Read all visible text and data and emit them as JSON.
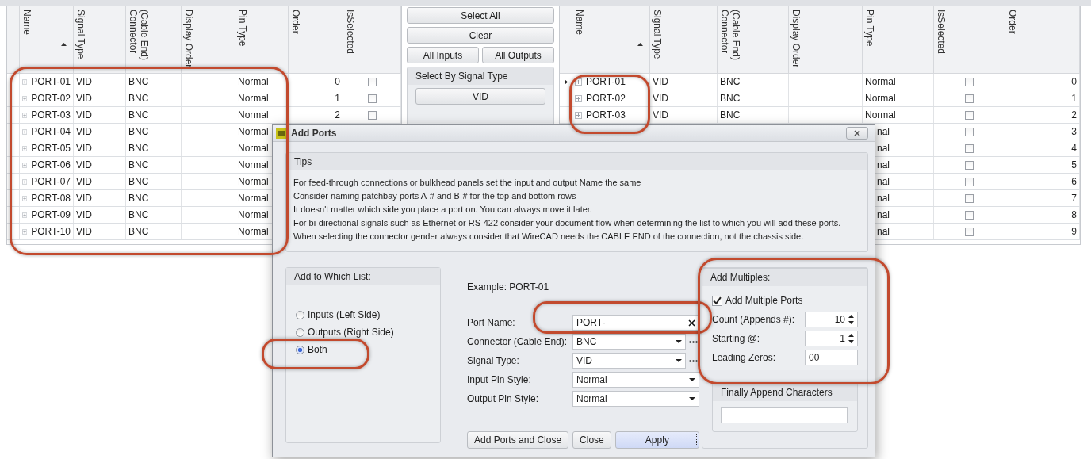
{
  "left_grid": {
    "columns": [
      {
        "label": "Name",
        "sorted": true
      },
      {
        "label": "Signal Type",
        "sorted": false
      },
      {
        "label": "(Cable End) Connector",
        "sorted": false
      },
      {
        "label": "Display Order",
        "sorted": false
      },
      {
        "label": "Pin Type",
        "sorted": false
      },
      {
        "label": "Order",
        "sorted": false
      },
      {
        "label": "IsSelected",
        "sorted": false
      }
    ],
    "rows": [
      {
        "cells": [
          {
            "kind": "name",
            "text": "PORT-01"
          },
          {
            "kind": "text",
            "text": "VID"
          },
          {
            "kind": "text",
            "text": "BNC"
          },
          {
            "kind": "blank"
          },
          {
            "kind": "text",
            "text": "Normal"
          },
          {
            "kind": "number",
            "text": "0"
          },
          {
            "kind": "checkbox",
            "checked": false
          }
        ]
      },
      {
        "cells": [
          {
            "kind": "name",
            "text": "PORT-02"
          },
          {
            "kind": "text",
            "text": "VID"
          },
          {
            "kind": "text",
            "text": "BNC"
          },
          {
            "kind": "blank"
          },
          {
            "kind": "text",
            "text": "Normal"
          },
          {
            "kind": "number",
            "text": "1"
          },
          {
            "kind": "checkbox",
            "checked": false
          }
        ]
      },
      {
        "cells": [
          {
            "kind": "name",
            "text": "PORT-03"
          },
          {
            "kind": "text",
            "text": "VID"
          },
          {
            "kind": "text",
            "text": "BNC"
          },
          {
            "kind": "blank"
          },
          {
            "kind": "text",
            "text": "Normal"
          },
          {
            "kind": "number",
            "text": "2"
          },
          {
            "kind": "checkbox",
            "checked": false
          }
        ]
      },
      {
        "cells": [
          {
            "kind": "name",
            "text": "PORT-04"
          },
          {
            "kind": "text",
            "text": "VID"
          },
          {
            "kind": "text",
            "text": "BNC"
          },
          {
            "kind": "blank"
          },
          {
            "kind": "text",
            "text": "Normal"
          },
          {
            "kind": "blank"
          },
          {
            "kind": "blank"
          }
        ]
      },
      {
        "cells": [
          {
            "kind": "name",
            "text": "PORT-05"
          },
          {
            "kind": "text",
            "text": "VID"
          },
          {
            "kind": "text",
            "text": "BNC"
          },
          {
            "kind": "blank"
          },
          {
            "kind": "text",
            "text": "Normal"
          },
          {
            "kind": "blank"
          },
          {
            "kind": "blank"
          }
        ]
      },
      {
        "cells": [
          {
            "kind": "name",
            "text": "PORT-06"
          },
          {
            "kind": "text",
            "text": "VID"
          },
          {
            "kind": "text",
            "text": "BNC"
          },
          {
            "kind": "blank"
          },
          {
            "kind": "text",
            "text": "Normal"
          },
          {
            "kind": "blank"
          },
          {
            "kind": "blank"
          }
        ]
      },
      {
        "cells": [
          {
            "kind": "name",
            "text": "PORT-07"
          },
          {
            "kind": "text",
            "text": "VID"
          },
          {
            "kind": "text",
            "text": "BNC"
          },
          {
            "kind": "blank"
          },
          {
            "kind": "text",
            "text": "Normal"
          },
          {
            "kind": "blank"
          },
          {
            "kind": "blank"
          }
        ]
      },
      {
        "cells": [
          {
            "kind": "name",
            "text": "PORT-08"
          },
          {
            "kind": "text",
            "text": "VID"
          },
          {
            "kind": "text",
            "text": "BNC"
          },
          {
            "kind": "blank"
          },
          {
            "kind": "text",
            "text": "Normal"
          },
          {
            "kind": "blank"
          },
          {
            "kind": "blank"
          }
        ]
      },
      {
        "cells": [
          {
            "kind": "name",
            "text": "PORT-09"
          },
          {
            "kind": "text",
            "text": "VID"
          },
          {
            "kind": "text",
            "text": "BNC"
          },
          {
            "kind": "blank"
          },
          {
            "kind": "text",
            "text": "Normal"
          },
          {
            "kind": "blank"
          },
          {
            "kind": "blank"
          }
        ]
      },
      {
        "cells": [
          {
            "kind": "name",
            "text": "PORT-10"
          },
          {
            "kind": "text",
            "text": "VID"
          },
          {
            "kind": "text",
            "text": "BNC"
          },
          {
            "kind": "blank"
          },
          {
            "kind": "text",
            "text": "Normal"
          },
          {
            "kind": "blank"
          },
          {
            "kind": "blank"
          }
        ]
      }
    ]
  },
  "selection_panel": {
    "buttons": [
      "Select All",
      "Clear",
      "All Inputs",
      "All Outputs"
    ],
    "signal_group": {
      "title": "Select By Signal Type",
      "buttons": [
        "VID"
      ]
    }
  },
  "right_grid": {
    "columns": [
      {
        "label": "Name",
        "sorted": true
      },
      {
        "label": "Signal Type",
        "sorted": false
      },
      {
        "label": "(Cable End) Connector",
        "sorted": false
      },
      {
        "label": "Display Order",
        "sorted": false
      },
      {
        "label": "Pin Type",
        "sorted": false
      },
      {
        "label": "IsSelected",
        "sorted": false
      },
      {
        "label": "Order",
        "sorted": false
      }
    ],
    "rows": [
      {
        "current": true,
        "cells": [
          {
            "kind": "name",
            "text": "PORT-01"
          },
          {
            "kind": "text",
            "text": "VID"
          },
          {
            "kind": "text",
            "text": "BNC"
          },
          {
            "kind": "blank"
          },
          {
            "kind": "text",
            "text": "Normal"
          },
          {
            "kind": "checkbox",
            "checked": false
          },
          {
            "kind": "number",
            "text": "0"
          }
        ]
      },
      {
        "current": false,
        "cells": [
          {
            "kind": "name",
            "text": "PORT-02"
          },
          {
            "kind": "text",
            "text": "VID"
          },
          {
            "kind": "text",
            "text": "BNC"
          },
          {
            "kind": "blank"
          },
          {
            "kind": "text",
            "text": "Normal"
          },
          {
            "kind": "checkbox",
            "checked": false
          },
          {
            "kind": "number",
            "text": "1"
          }
        ]
      },
      {
        "current": false,
        "cells": [
          {
            "kind": "name",
            "text": "PORT-03"
          },
          {
            "kind": "text",
            "text": "VID"
          },
          {
            "kind": "text",
            "text": "BNC"
          },
          {
            "kind": "blank"
          },
          {
            "kind": "text",
            "text": "Normal"
          },
          {
            "kind": "checkbox",
            "checked": false
          },
          {
            "kind": "number",
            "text": "2"
          }
        ]
      },
      {
        "cells": [
          {
            "kind": "blank"
          },
          {
            "kind": "blank"
          },
          {
            "kind": "blank"
          },
          {
            "kind": "blank"
          },
          {
            "kind": "cut",
            "text": "nal"
          },
          {
            "kind": "checkbox",
            "checked": false
          },
          {
            "kind": "number",
            "text": "3"
          }
        ]
      },
      {
        "cells": [
          {
            "kind": "blank"
          },
          {
            "kind": "blank"
          },
          {
            "kind": "blank"
          },
          {
            "kind": "blank"
          },
          {
            "kind": "cut",
            "text": "nal"
          },
          {
            "kind": "checkbox",
            "checked": false
          },
          {
            "kind": "number",
            "text": "4"
          }
        ]
      },
      {
        "cells": [
          {
            "kind": "blank"
          },
          {
            "kind": "blank"
          },
          {
            "kind": "blank"
          },
          {
            "kind": "blank"
          },
          {
            "kind": "cut",
            "text": "nal"
          },
          {
            "kind": "checkbox",
            "checked": false
          },
          {
            "kind": "number",
            "text": "5"
          }
        ]
      },
      {
        "cells": [
          {
            "kind": "blank"
          },
          {
            "kind": "blank"
          },
          {
            "kind": "blank"
          },
          {
            "kind": "blank"
          },
          {
            "kind": "cut",
            "text": "nal"
          },
          {
            "kind": "checkbox",
            "checked": false
          },
          {
            "kind": "number",
            "text": "6"
          }
        ]
      },
      {
        "cells": [
          {
            "kind": "blank"
          },
          {
            "kind": "blank"
          },
          {
            "kind": "blank"
          },
          {
            "kind": "blank"
          },
          {
            "kind": "cut",
            "text": "nal"
          },
          {
            "kind": "checkbox",
            "checked": false
          },
          {
            "kind": "number",
            "text": "7"
          }
        ]
      },
      {
        "cells": [
          {
            "kind": "blank"
          },
          {
            "kind": "blank"
          },
          {
            "kind": "blank"
          },
          {
            "kind": "blank"
          },
          {
            "kind": "cut",
            "text": "nal"
          },
          {
            "kind": "checkbox",
            "checked": false
          },
          {
            "kind": "number",
            "text": "8"
          }
        ]
      },
      {
        "cells": [
          {
            "kind": "blank"
          },
          {
            "kind": "blank"
          },
          {
            "kind": "blank"
          },
          {
            "kind": "blank"
          },
          {
            "kind": "cut",
            "text": "nal"
          },
          {
            "kind": "checkbox",
            "checked": false
          },
          {
            "kind": "number",
            "text": "9"
          }
        ]
      }
    ]
  },
  "dialog": {
    "title": "Add Ports",
    "tips": {
      "title": "Tips",
      "lines": [
        "For feed-through connections or bulkhead panels set the input and output Name the same",
        "Consider naming patchbay ports A-# and B-# for the top and bottom rows",
        "It doesn't matter which side you place a port on. You can always move it later.",
        "For bi-directional signals such as Ethernet or RS-422 consider your document flow when determining the list to which you will add these ports.",
        "When selecting the connector gender always consider that WireCAD needs the CABLE END of the connection, not the chassis side."
      ]
    },
    "list_group": {
      "title": "Add to Which List:",
      "options": [
        {
          "label": "Inputs (Left Side)",
          "selected": false
        },
        {
          "label": "Outputs (Right Side)",
          "selected": false
        },
        {
          "label": "Both",
          "selected": true
        }
      ]
    },
    "example": "Example: PORT-01",
    "fields": [
      {
        "kind": "text",
        "label": "Port Name:",
        "value": "PORT-"
      },
      {
        "kind": "combo_more",
        "label": "Connector (Cable End):",
        "value": "BNC"
      },
      {
        "kind": "combo_more",
        "label": "Signal Type:",
        "value": "VID"
      },
      {
        "kind": "combo",
        "label": "Input Pin Style:",
        "value": "Normal"
      },
      {
        "kind": "combo",
        "label": "Output Pin Style:",
        "value": "Normal"
      }
    ],
    "multiples": {
      "title": "Add Multiples:",
      "checkbox": {
        "label": "Add Multiple Ports",
        "checked": true
      },
      "fields": [
        {
          "kind": "spin",
          "label": "Count (Appends #):",
          "value": "10"
        },
        {
          "kind": "spin",
          "label": "Starting @:",
          "value": "1"
        },
        {
          "kind": "text",
          "label": "Leading Zeros:",
          "value": "00"
        }
      ]
    },
    "append_group": {
      "title": "Finally Append Characters"
    },
    "buttons": [
      {
        "label": "Add Ports and Close",
        "focused": false
      },
      {
        "label": "Close",
        "focused": false
      },
      {
        "label": "Apply",
        "focused": true
      }
    ]
  }
}
